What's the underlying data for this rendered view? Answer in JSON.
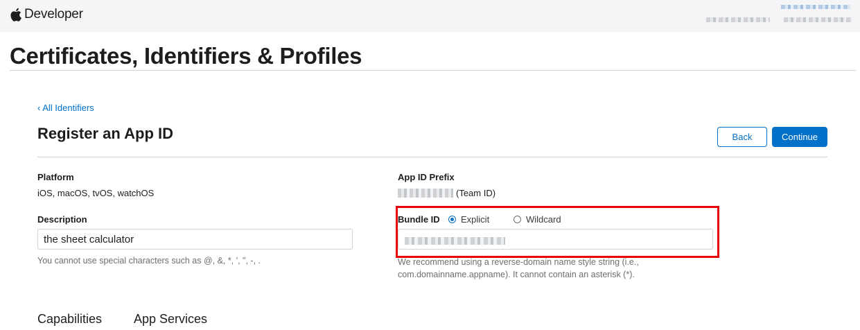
{
  "header": {
    "brand": "Developer",
    "logo_icon": "apple-logo-icon"
  },
  "page_title": "Certificates, Identifiers & Profiles",
  "breadcrumb": {
    "back_link": "‹ All Identifiers"
  },
  "form": {
    "title": "Register an App ID",
    "back_label": "Back",
    "continue_label": "Continue",
    "platform": {
      "label": "Platform",
      "value": "iOS, macOS, tvOS, watchOS"
    },
    "app_id_prefix": {
      "label": "App ID Prefix",
      "suffix": "(Team ID)"
    },
    "description": {
      "label": "Description",
      "value": "the sheet calculator",
      "hint": "You cannot use special characters such as @, &, *, ', \", -, ."
    },
    "bundle_id": {
      "label": "Bundle ID",
      "options": [
        {
          "label": "Explicit",
          "checked": true
        },
        {
          "label": "Wildcard",
          "checked": false
        }
      ],
      "hint_line1": "We recommend using a reverse-domain name style string (i.e.,",
      "hint_line2": "com.domainname.appname). It cannot contain an asterisk (*)."
    }
  },
  "tabs": [
    {
      "label": "Capabilities"
    },
    {
      "label": "App Services"
    }
  ],
  "colors": {
    "accent": "#0070c9",
    "highlight": "#e8000b",
    "header_bg": "#f5f5f7"
  }
}
